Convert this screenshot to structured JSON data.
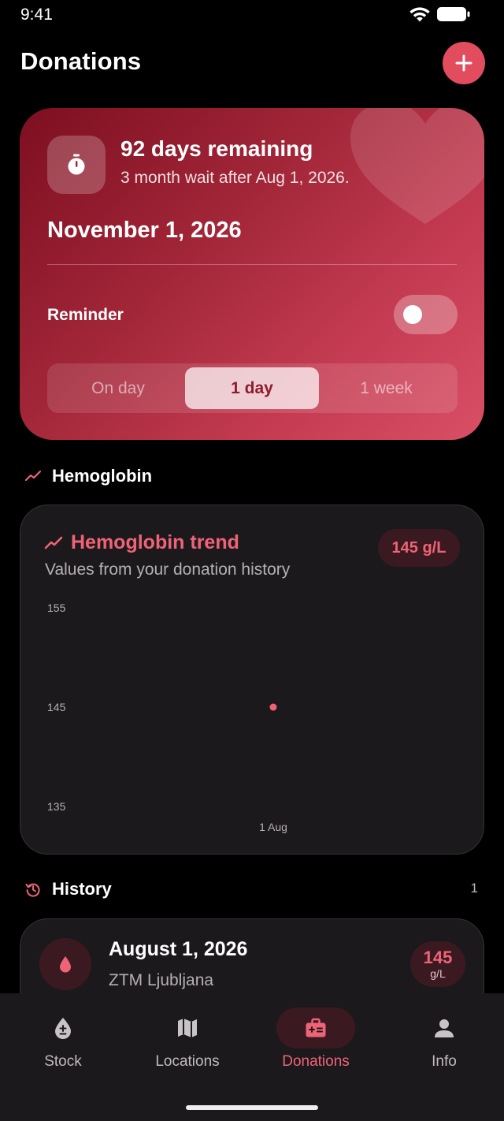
{
  "status_bar": {
    "time": "9:41"
  },
  "header": {
    "title": "Donations",
    "add_icon": "plus-icon"
  },
  "countdown": {
    "remaining": "92 days remaining",
    "wait_note": "3 month wait after Aug 1, 2026.",
    "next_date": "November 1, 2026",
    "reminder_label": "Reminder",
    "reminder_enabled": false,
    "segments": [
      "On day",
      "1 day",
      "1 week"
    ],
    "selected_segment": "1 day",
    "icon": "timer-icon",
    "colors": {
      "gradient_start": "#7d0f20",
      "gradient_end": "#d94f65"
    }
  },
  "hemoglobin_section": {
    "title": "Hemoglobin",
    "icon": "trend-icon"
  },
  "hemoglobin_card": {
    "title": "Hemoglobin trend",
    "subtitle": "Values from your donation history",
    "badge": "145 g/L"
  },
  "chart_data": {
    "type": "scatter",
    "x": [
      "1 Aug"
    ],
    "values": [
      145
    ],
    "yticks": [
      "155",
      "145",
      "135"
    ],
    "ylim": [
      135,
      155
    ],
    "grid": false,
    "color": "#f06377"
  },
  "history_section": {
    "title": "History",
    "count": "1",
    "icon": "history-icon"
  },
  "history": [
    {
      "date": "August 1, 2026",
      "location": "ZTM Ljubljana",
      "value": "145",
      "unit": "g/L",
      "icon": "blood-drop-icon"
    }
  ],
  "nav": [
    {
      "label": "Stock",
      "icon": "blood-drop-plus-minus-icon",
      "active": false
    },
    {
      "label": "Locations",
      "icon": "map-icon",
      "active": false
    },
    {
      "label": "Donations",
      "icon": "medical-kit-icon",
      "active": true
    },
    {
      "label": "Info",
      "icon": "person-icon",
      "active": false
    }
  ],
  "colors": {
    "accent": "#e14c5e",
    "accent_text": "#f06377",
    "surface": "#1c191c",
    "background": "#000000"
  }
}
